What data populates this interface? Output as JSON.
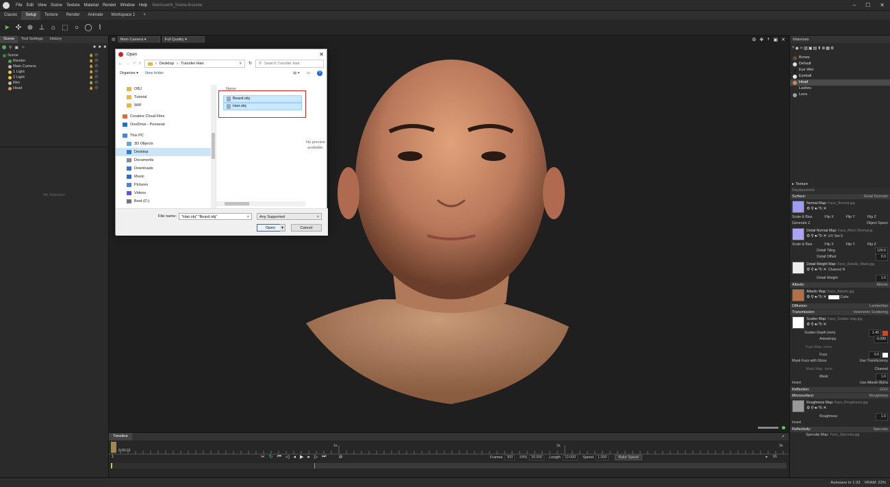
{
  "menubar": {
    "items": [
      "File",
      "Edit",
      "View",
      "Scene",
      "Texture",
      "Material",
      "Render",
      "Window",
      "Help"
    ],
    "window_title": "Marmoset4_Scene.tbscene"
  },
  "tabs": {
    "items": [
      "Classic",
      "Setup",
      "Texture",
      "Render",
      "Animate",
      "Workspace 1",
      "+"
    ],
    "active": "Setup"
  },
  "left_panel": {
    "tabs": [
      "Scene",
      "Tool Settings",
      "History"
    ],
    "tree": [
      {
        "label": "Scene",
        "icon": "scene-icon",
        "color": "#3a8a3a"
      },
      {
        "label": "Render",
        "icon": "render-icon",
        "color": "#4aa84a"
      },
      {
        "label": "Main Camera",
        "icon": "camera-icon",
        "color": "#bbbbbb"
      },
      {
        "label": "1 Light",
        "icon": "light-icon",
        "color": "#e8c840"
      },
      {
        "label": "2 Light",
        "icon": "light-icon",
        "color": "#e8c840"
      },
      {
        "label": "Rim",
        "icon": "light-icon",
        "color": "#bbbbbb"
      },
      {
        "label": "Head",
        "icon": "folder-icon",
        "color": "#d9a441"
      }
    ],
    "no_selection": "No Selection"
  },
  "viewport": {
    "camera": "Main Camera",
    "quality": "Full Quality",
    "no_preview": "No preview available."
  },
  "dialog": {
    "title": "Open",
    "path": [
      "Desktop",
      "Transfer Hair"
    ],
    "search_placeholder": "Search Transfer Hair",
    "organise": "Organise",
    "new_folder": "New folder",
    "nav_items": [
      {
        "label": "OBJ",
        "icon": "folder-icon"
      },
      {
        "label": "Tutorial",
        "icon": "folder-icon"
      },
      {
        "label": "WIP",
        "icon": "folder-icon"
      },
      {
        "label": "Creative Cloud Files",
        "icon": "cloud-icon"
      },
      {
        "label": "OneDrive - Personal",
        "icon": "onedrive-icon"
      },
      {
        "label": "This PC",
        "icon": "pc-icon"
      },
      {
        "label": "3D Objects",
        "icon": "cube-icon"
      },
      {
        "label": "Desktop",
        "icon": "desktop-icon"
      },
      {
        "label": "Documents",
        "icon": "document-icon"
      },
      {
        "label": "Downloads",
        "icon": "download-icon"
      },
      {
        "label": "Music",
        "icon": "music-icon"
      },
      {
        "label": "Pictures",
        "icon": "picture-icon"
      },
      {
        "label": "Videos",
        "icon": "video-icon"
      },
      {
        "label": "Boot (C:)",
        "icon": "drive-icon"
      }
    ],
    "selected_nav": "Desktop",
    "column_header": "Name",
    "files": [
      "Beard.obj",
      "Hair.obj"
    ],
    "file_name_label": "File name:",
    "file_name_value": "\"Hair.obj\" \"Beard.obj\"",
    "file_type": "Any Supported",
    "open_label": "Open",
    "cancel_label": "Cancel"
  },
  "right_panel": {
    "header": "Materials",
    "materials": [
      {
        "label": "Brows",
        "color": "#6b4a2f"
      },
      {
        "label": "Default",
        "color": "#dddddd"
      },
      {
        "label": "Eye Wet",
        "color": "#222222"
      },
      {
        "label": "Eyeball",
        "color": "#e8e8e8"
      },
      {
        "label": "Head",
        "color": "#c9895f"
      },
      {
        "label": "Lashes",
        "color": "#3a2a20"
      },
      {
        "label": "Lens",
        "color": "#9aa0a8"
      }
    ],
    "selected_material": "Head",
    "texture_label": "Texture",
    "displacement": "Displacement",
    "surface": {
      "label": "Surface:",
      "value": "Detail Normals"
    },
    "normal_map": {
      "name": "Normal Map:",
      "file": "Face_Normal.jpg"
    },
    "scale_bias": "Scale & Bias",
    "flip_x": "Flip X",
    "flip_y": "Flip Y",
    "flip_z": "Flip Z",
    "generate_z": "Generate Z",
    "object_space": "Object Space",
    "detail_normal_map": {
      "name": "Detail Normal Map:",
      "file": "Face_Micro Normal.jp"
    },
    "uv_set": "UV Set",
    "uv_value": "0",
    "detail_tiling": {
      "label": "Detail Tiling",
      "value": "120.0"
    },
    "detail_offset": {
      "label": "Detail Offset",
      "value": "0.0"
    },
    "detail_weight_map": {
      "name": "Detail Weight Map:",
      "file": "Face_Details_Mask.jpg"
    },
    "channel": "Channel",
    "channel_value": "R",
    "detail_weight": {
      "label": "Detail Weight",
      "value": "1.0"
    },
    "albedo": {
      "label": "Albedo:",
      "value": "Albedo"
    },
    "albedo_map": {
      "name": "Albedo Map:",
      "file": "Face_Albedo.jpg"
    },
    "color_label": "Color",
    "diffusion": {
      "label": "Diffusion:",
      "value": "Lambertian"
    },
    "transmission": {
      "label": "Transmission:",
      "value": "Volumetric Scattering"
    },
    "scatter_map": {
      "name": "Scatter Map:",
      "file": "Face_Scatter map.jpg"
    },
    "scatter_depth": {
      "label": "Scatter Depth (mm)",
      "value": "1.45"
    },
    "anisotropy": {
      "label": "Anisotropy",
      "value": "-0.099"
    },
    "fuzz_map": {
      "name": "Fuzz Map:",
      "file": "none"
    },
    "fuzz": {
      "label": "Fuzz",
      "value": "0.0"
    },
    "mask_fuzz": "Mask Fuzz with Gloss",
    "use_translucency": "Use Translucency",
    "mask_map": {
      "name": "Mask Map:",
      "file": "none"
    },
    "mask": {
      "label": "Mask",
      "value": "1.0"
    },
    "invert": "Invert",
    "use_albedo_alpha": "Use Albedo Alpha",
    "reflection": {
      "label": "Reflection:",
      "value": "GGX"
    },
    "microsurface": {
      "label": "Microsurface:",
      "value": "Roughness"
    },
    "roughness_map": {
      "name": "Roughness Map:",
      "file": "Face_Roughness.jpg"
    },
    "roughness": {
      "label": "Roughness",
      "value": "1.0"
    },
    "invert2": "Invert",
    "reflectivity": {
      "label": "Reflectivity:",
      "value": "Specular"
    },
    "specular_map": {
      "name": "Specular Map:",
      "file": "Face_Specular.jpg"
    }
  },
  "timeline": {
    "label": "Timeline",
    "time": "0:00.01",
    "ticks": [
      "1s",
      "2s",
      "3s"
    ],
    "frames_label": "Frames",
    "frames": "300",
    "fps_label": "FPS",
    "fps": "30.000",
    "length_label": "Length",
    "length": "10.000",
    "speed_label": "Speed",
    "speed": "1.000",
    "bake_speed": "Bake Speed",
    "frame_start": "1",
    "frame_end": "91"
  },
  "status": {
    "autosave": "Autosave in 1:33",
    "vram": "VRAM: 23%"
  }
}
